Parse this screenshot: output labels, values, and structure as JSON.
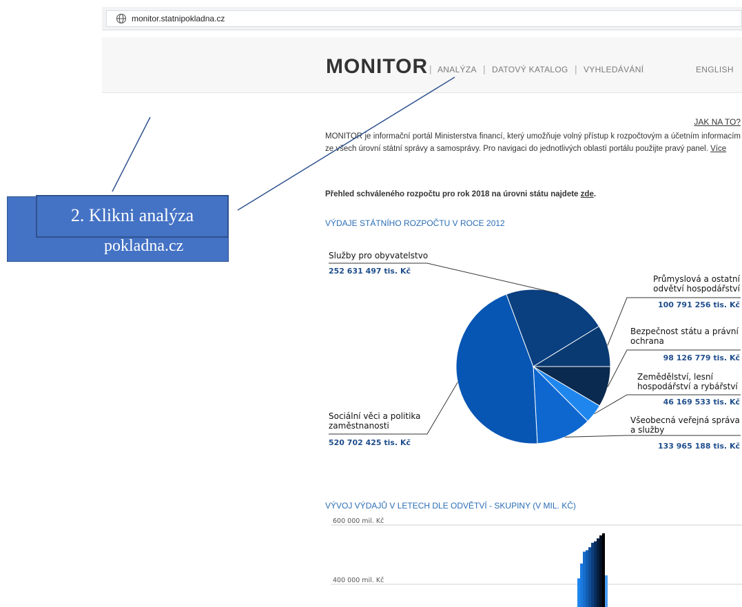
{
  "browser": {
    "url": "monitor.statnipokladna.cz",
    "icon": "globe-icon"
  },
  "site": {
    "logo": "MONITOR",
    "nav": [
      {
        "label": "ANALÝZA"
      },
      {
        "label": "DATOVÝ KATALOG"
      },
      {
        "label": "VYHLEDÁVÁNÍ"
      }
    ],
    "separator": "|",
    "language": "ENGLISH"
  },
  "content": {
    "help_link": "JAK NA TO?",
    "intro": "MONITOR je informační portál Ministerstva financí, který umožňuje volný přístup k rozpočtovým a účetním informacím ze všech úrovní státní správy a samosprávy. Pro navigaci do jednotlivých oblastí portálu použijte pravý panel.",
    "more_link": "Více",
    "budget_text": "Přehled schváleného rozpočtu pro rok 2018 na úrovni státu najdete",
    "budget_link": "zde",
    "budget_end": "."
  },
  "chart_data": [
    {
      "type": "pie",
      "title": "VÝDAJE STÁTNÍHO ROZPOČTU V ROCE 2012",
      "unit": "tis. Kč",
      "slices": [
        {
          "label": "Bezpečnost státu a právní ochrana",
          "value": 98126779,
          "value_text": "98 126 779 tis. Kč",
          "color": "#0b2a4f"
        },
        {
          "label": "Zemědělství, lesní hospodářství a rybářství",
          "value": 46169533,
          "value_text": "46 169 533 tis. Kč",
          "color": "#1f86ee"
        },
        {
          "label": "Všeobecná veřejná správa a služby",
          "value": 133965188,
          "value_text": "133 965 188 tis. Kč",
          "color": "#0d67cf"
        },
        {
          "label": "Sociální věci a politika zaměstnanosti",
          "value": 520702425,
          "value_text": "520 702 425 tis. Kč",
          "color": "#0756b3"
        },
        {
          "label": "Služby pro obyvatelstvo",
          "value": 252631497,
          "value_text": "252 631 497 tis. Kč",
          "color": "#0a3f80"
        },
        {
          "label": "Průmyslová a ostatní odvětví hospodářství",
          "value": 100791256,
          "value_text": "100 791 256 tis. Kč",
          "color": "#0a3a72"
        }
      ]
    },
    {
      "type": "bar",
      "title": "VÝVOJ VÝDAJŮ V LETECH DLE ODVĚTVÍ - SKUPINY (V MIL. KČ)",
      "ytick_labels": [
        "600 000 mil. Kč",
        "400 000 mil. Kč"
      ],
      "yticks": [
        600000,
        400000
      ],
      "series": [
        {
          "values": [
            420000
          ],
          "color": "#1f86ee"
        },
        {
          "values": [
            470000
          ],
          "color": "#1a7ae0"
        },
        {
          "values": [
            510000
          ],
          "color": "#166dcc"
        },
        {
          "values": [
            515000
          ],
          "color": "#125eb3"
        },
        {
          "values": [
            525000
          ],
          "color": "#0f4f99"
        },
        {
          "values": [
            540000
          ],
          "color": "#0c3f7d"
        },
        {
          "values": [
            545000
          ],
          "color": "#092f5f"
        },
        {
          "values": [
            555000
          ],
          "color": "#061f40"
        },
        {
          "values": [
            565000
          ],
          "color": "#031024"
        },
        {
          "values": [
            572000
          ],
          "color": "#000000"
        },
        {
          "values": [
            430000
          ],
          "color": "#4a9cf2"
        }
      ]
    }
  ],
  "annotation": {
    "front_text": "2. Klikni analýza",
    "back_text": "pokladna.cz",
    "color": "#4472c4"
  }
}
